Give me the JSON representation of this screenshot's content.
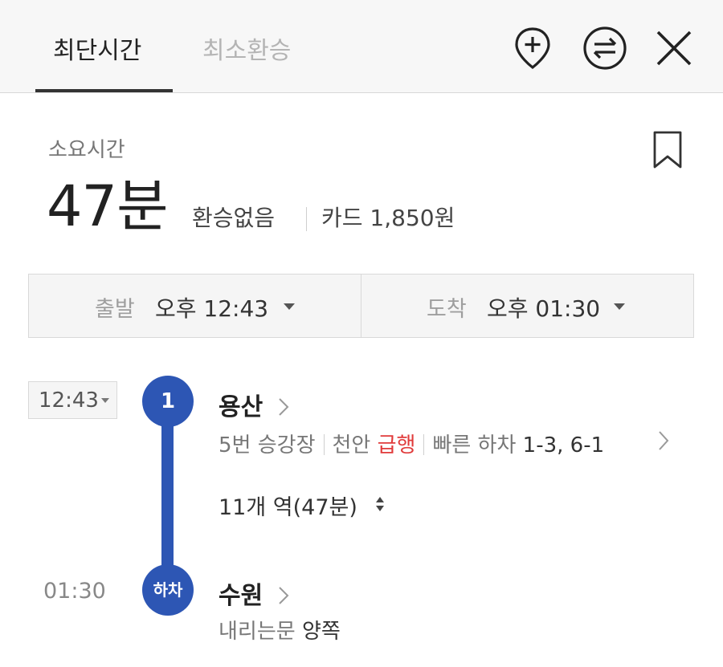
{
  "tabs": [
    {
      "label": "최단시간",
      "active": true
    },
    {
      "label": "최소환승",
      "active": false
    }
  ],
  "header_icons": [
    "add-location-icon",
    "swap-icon",
    "close-icon"
  ],
  "summary": {
    "duration_label": "소요시간",
    "duration_value": "47분",
    "transfers": "환승없음",
    "fare": "카드 1,850원"
  },
  "time_selector": {
    "departure_label": "출발",
    "departure_time": "오후 12:43",
    "arrival_label": "도착",
    "arrival_time": "오후 01:30"
  },
  "route": {
    "start_time": "12:43",
    "line_badge": "1",
    "line_color": "#2d56b4",
    "start_station": "용산",
    "platform": "5번 승강장",
    "direction": "천안",
    "train_type": "급행",
    "quick_exit_label": "빠른 하차",
    "quick_exit_doors": "1-3, 6-1",
    "stops_summary": "11개 역(47분)",
    "end_time": "01:30",
    "end_badge": "하차",
    "end_station": "수원",
    "exit_door_label": "내리는문",
    "exit_door_value": "양쪽"
  }
}
